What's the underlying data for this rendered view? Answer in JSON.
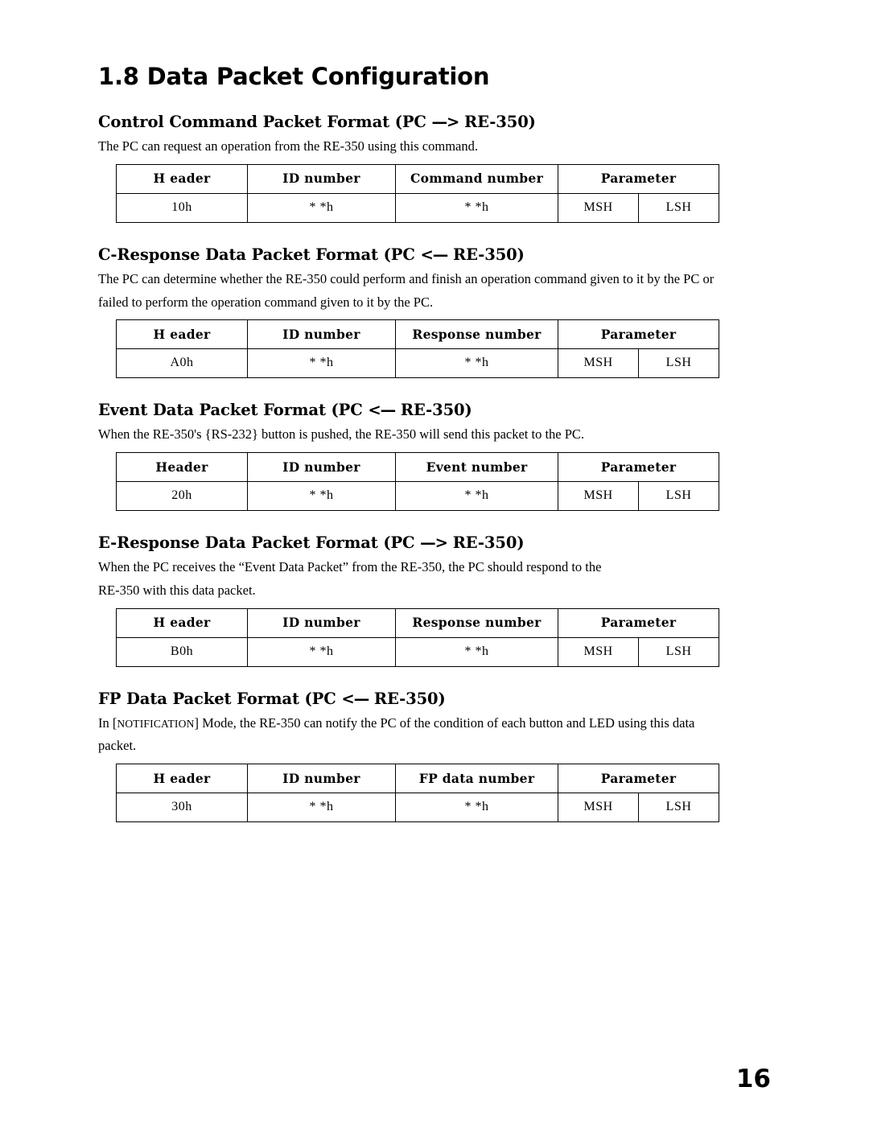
{
  "page": {
    "title": "1.8 Data Packet Configuration",
    "number": "16"
  },
  "sections": [
    {
      "heading_main": "Control Command Packet Format (PC ",
      "heading_arrow": "—>",
      "heading_tail": " RE-350)",
      "paragraphs": [
        "The PC can request an operation from the RE-350 using this command."
      ],
      "table": {
        "headers": [
          "H eader",
          "ID number",
          "Command number",
          "Parameter"
        ],
        "values": [
          "10h",
          "* *h",
          "* *h",
          "MSH",
          "LSH"
        ]
      }
    },
    {
      "heading_main": "C-Response Data Packet Format (PC ",
      "heading_arrow": "<—",
      "heading_tail": " RE-350)",
      "paragraphs": [
        "The PC can determine whether the RE-350 could perform and finish an operation command given to it by the PC or",
        "failed to perform the operation command given to it by the PC."
      ],
      "table": {
        "headers": [
          "H eader",
          "ID number",
          "Response number",
          "Parameter"
        ],
        "values": [
          "A0h",
          "* *h",
          "* *h",
          "MSH",
          "LSH"
        ]
      }
    },
    {
      "heading_main": "Event Data Packet Format (PC ",
      "heading_arrow": "<—",
      "heading_tail": " RE-350)",
      "paragraphs": [
        "When the RE-350's {RS-232} button is pushed, the RE-350 will send this packet to the PC."
      ],
      "table": {
        "headers": [
          "Header",
          "ID number",
          "Event number",
          "Parameter"
        ],
        "values": [
          "20h",
          "* *h",
          "* *h",
          "MSH",
          "LSH"
        ]
      }
    },
    {
      "heading_main": "E-Response Data Packet Format (PC ",
      "heading_arrow": "—>",
      "heading_tail": " RE-350)",
      "paragraphs": [
        "When the PC receives the “Event Data Packet” from the RE-350, the PC should respond to the",
        "RE-350 with this data packet."
      ],
      "table": {
        "headers": [
          "H eader",
          "ID number",
          "Response number",
          "Parameter"
        ],
        "values": [
          "B0h",
          "* *h",
          "* *h",
          "MSH",
          "LSH"
        ]
      }
    },
    {
      "heading_main": "FP Data Packet Format (PC ",
      "heading_arrow": "<—",
      "heading_tail": " RE-350)",
      "paragraphs_rich": {
        "lead": "In [",
        "smallcaps": "NOTIFICATION",
        "rest": "] Mode, the RE-350 can notify the PC of the condition of each button  and LED using this data",
        "line2": "packet."
      },
      "table": {
        "headers": [
          "H eader",
          "ID number",
          "FP data number",
          "Parameter"
        ],
        "values": [
          "30h",
          "* *h",
          "* *h",
          "MSH",
          "LSH"
        ]
      }
    }
  ]
}
